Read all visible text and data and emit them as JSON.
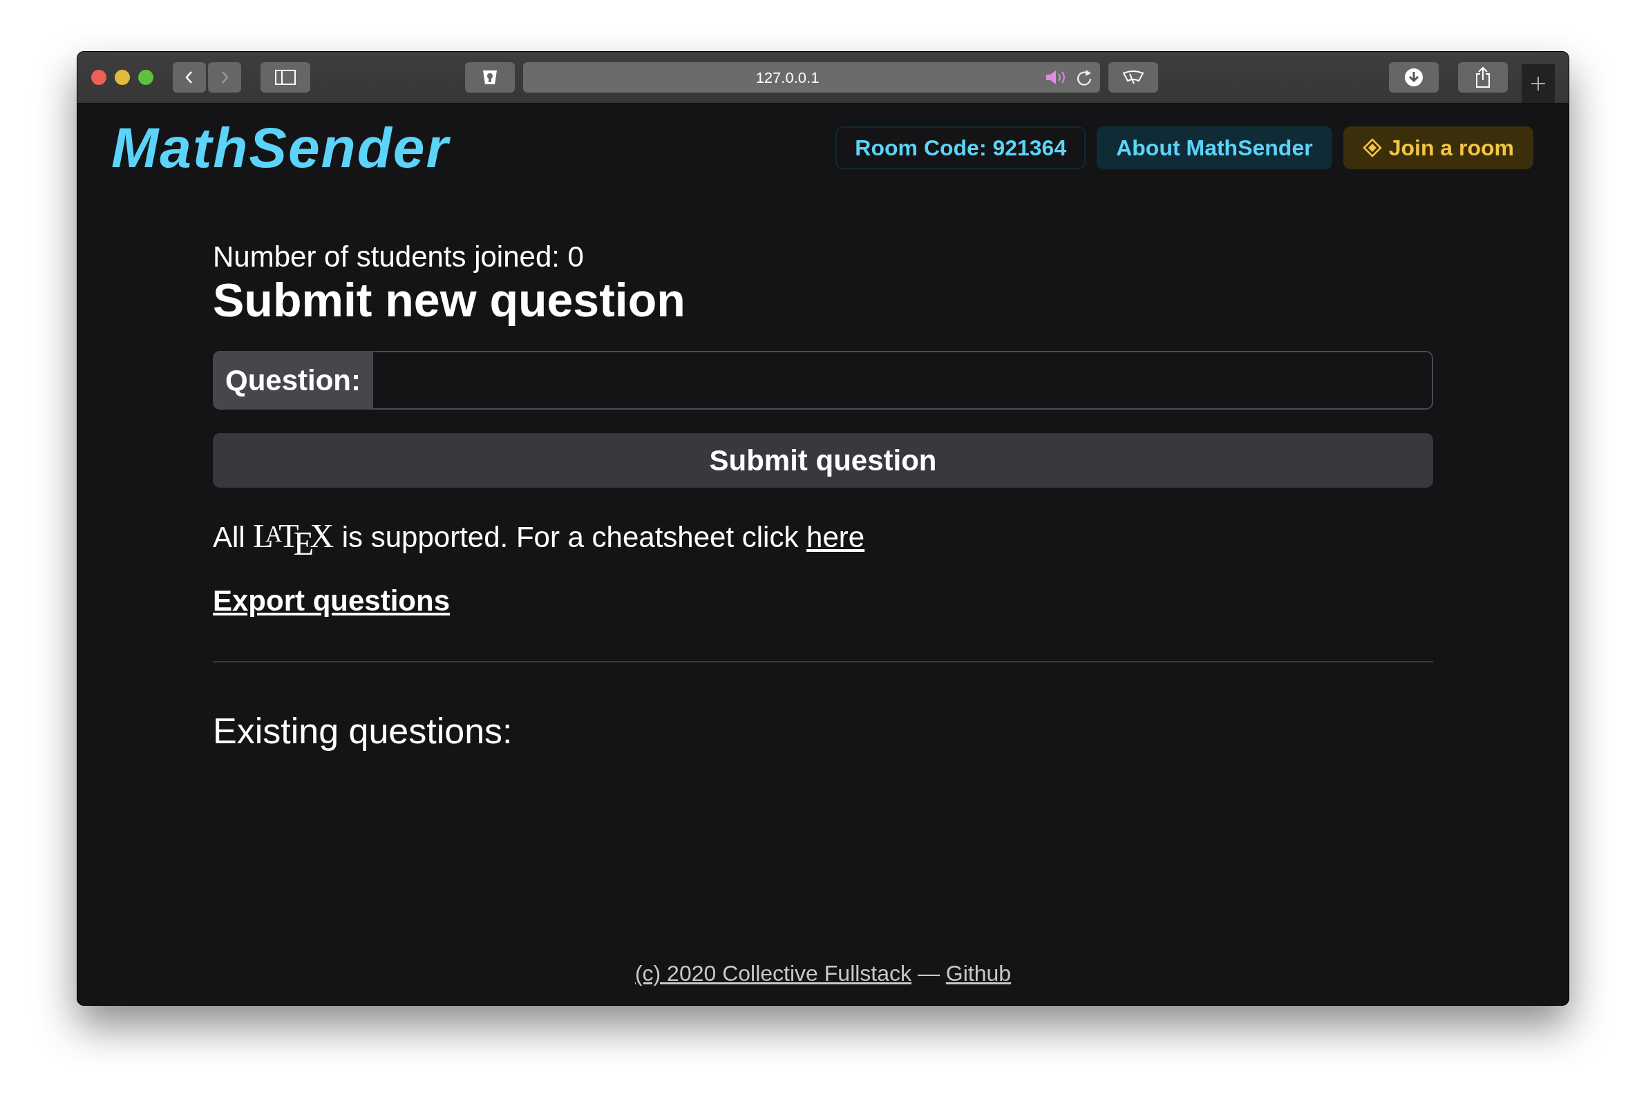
{
  "browser": {
    "url": "127.0.0.1",
    "nav_buttons": [
      {
        "kind": "back",
        "disabled": false
      },
      {
        "kind": "forward",
        "disabled": true
      }
    ]
  },
  "header": {
    "logo": "MathSender",
    "buttons": [
      {
        "kind": "outline",
        "label": "Room Code: 921364"
      },
      {
        "kind": "info",
        "label": "About MathSender"
      },
      {
        "kind": "warning",
        "label": "Join a room"
      }
    ]
  },
  "main": {
    "students_joined": "Number of students joined: 0",
    "heading": "Submit new question",
    "question_label": "Question:",
    "submit_button": "Submit question",
    "latex_note": {
      "before": "All",
      "logo": "L$^{A}$T$_{E}$X",
      "after": "is supported. For a cheatsheet click",
      "link": "here"
    },
    "export_link": "Export questions",
    "existing_heading": "Existing questions:"
  },
  "footer": {
    "copyright_link": "(c) 2020 Collective Fullstack",
    "separator": "—",
    "github_link": "Github"
  }
}
